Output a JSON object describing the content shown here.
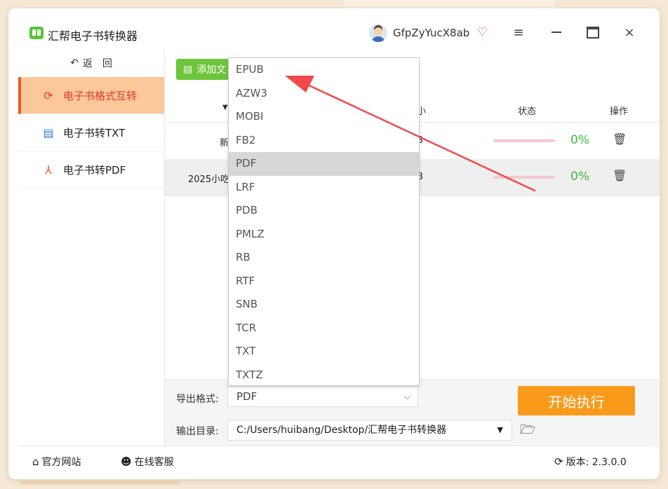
{
  "app": {
    "title": "汇帮电子书转换器"
  },
  "user": {
    "name": "GfpZyYucX8ab"
  },
  "window_controls": {
    "menu": "≡",
    "minimize": "",
    "maximize": "",
    "close": "×"
  },
  "sidebar": {
    "back_label": "返　回",
    "items": [
      {
        "label": "电子书格式互转",
        "icon": "refresh-icon",
        "active": true
      },
      {
        "label": "电子书转TXT",
        "icon": "document-icon",
        "active": false
      },
      {
        "label": "电子书转PDF",
        "icon": "pdf-icon",
        "active": false
      }
    ]
  },
  "main": {
    "add_button": "添加文",
    "columns": {
      "size": "小",
      "status": "状态",
      "operation": "操作"
    },
    "rows": [
      {
        "name": "新",
        "size": "B",
        "progress": 0,
        "percent": "0%"
      },
      {
        "name": "2025小吃",
        "size": "B",
        "progress": 0,
        "percent": "0%"
      }
    ]
  },
  "bottom": {
    "format_label": "导出格式:",
    "format_value": "PDF",
    "output_label": "输出目录:",
    "output_value": "C:/Users/huibang/Desktop/汇帮电子书转换器",
    "start_button": "开始执行"
  },
  "dropdown": {
    "options": [
      "EPUB",
      "AZW3",
      "MOBI",
      "FB2",
      "PDF",
      "LRF",
      "PDB",
      "PMLZ",
      "RB",
      "RTF",
      "SNB",
      "TCR",
      "TXT",
      "TXTZ"
    ],
    "selected": "PDF"
  },
  "footer": {
    "website": "官方网站",
    "service": "在线客服",
    "version": "版本:  2.3.0.0"
  },
  "colors": {
    "accent": "#fa9a1a",
    "active_bg": "#fcc79a",
    "active_text": "#e33b2b",
    "success": "#3bbb3b",
    "add_button": "#6cc53a",
    "annotation_arrow": "#f0494b"
  }
}
